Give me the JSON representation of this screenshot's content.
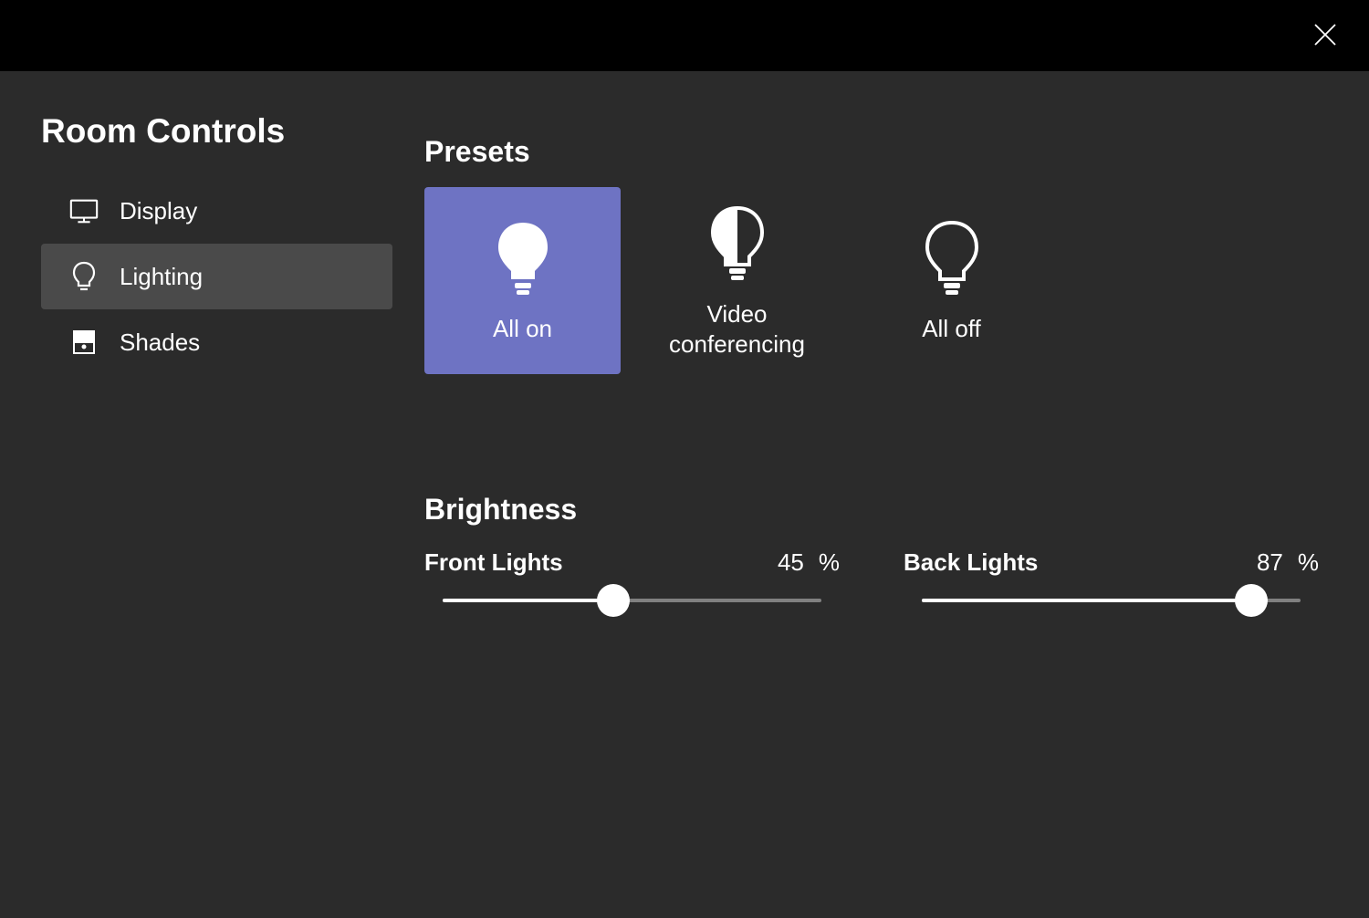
{
  "header": {},
  "page_title": "Room Controls",
  "sidebar": {
    "items": [
      {
        "label": "Display",
        "icon": "monitor",
        "active": false
      },
      {
        "label": "Lighting",
        "icon": "bulb",
        "active": true
      },
      {
        "label": "Shades",
        "icon": "shades",
        "active": false
      }
    ]
  },
  "presets": {
    "title": "Presets",
    "items": [
      {
        "label": "All on",
        "icon": "bulb-full",
        "active": true
      },
      {
        "label": "Video conferencing",
        "icon": "bulb-half",
        "active": false
      },
      {
        "label": "All off",
        "icon": "bulb-outline",
        "active": false
      }
    ]
  },
  "brightness": {
    "title": "Brightness",
    "sliders": [
      {
        "label": "Front Lights",
        "value": 45,
        "unit": "%"
      },
      {
        "label": "Back Lights",
        "value": 87,
        "unit": "%"
      }
    ]
  }
}
